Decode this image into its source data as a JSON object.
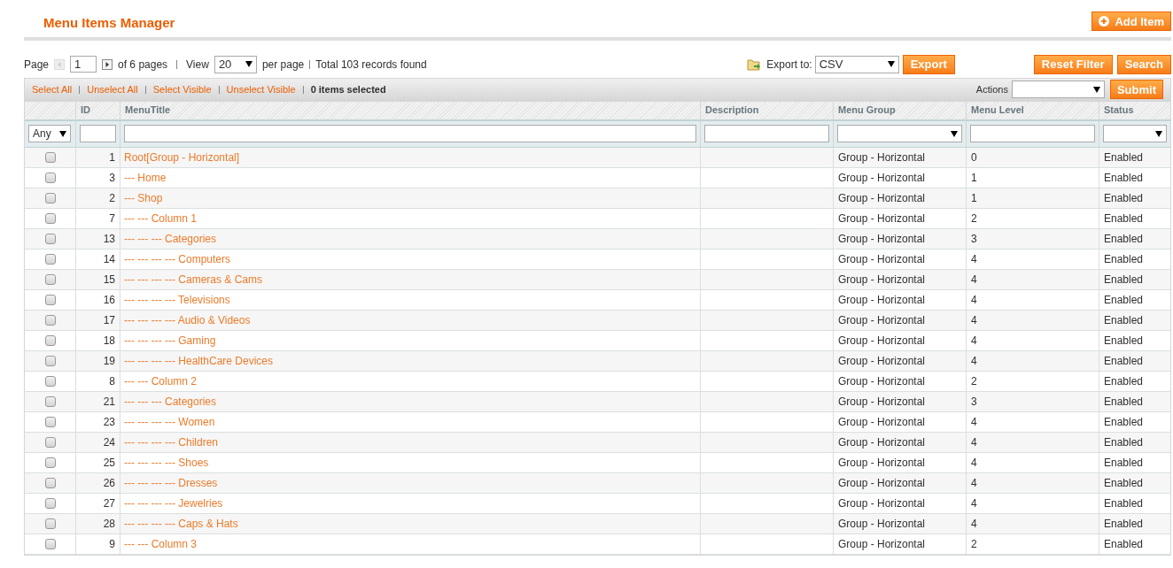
{
  "title": "Menu Items Manager",
  "add_button": "Add Item",
  "pager": {
    "page_label": "Page",
    "page": "1",
    "of_pages": "of 6 pages",
    "view_label": "View",
    "per_page": "20",
    "per_page_label": "per page",
    "total": "Total 103 records found"
  },
  "export": {
    "label": "Export to:",
    "format": "CSV",
    "button": "Export"
  },
  "filter_buttons": [
    "Reset Filter",
    "Search"
  ],
  "massaction": {
    "links": [
      "Select All",
      "Unselect All",
      "Select Visible",
      "Unselect Visible"
    ],
    "selected_count": "0 items selected",
    "actions_label": "Actions",
    "submit": "Submit"
  },
  "table": {
    "columns": [
      "ID",
      "MenuTitle",
      "Description",
      "Menu Group",
      "Menu Level",
      "Status"
    ],
    "filters": {
      "any": "Any"
    },
    "rows": [
      {
        "checked": false,
        "id": "1",
        "title": "Root[Group - Horizontal]",
        "group": "Group - Horizontal",
        "level": "0",
        "status": "Enabled"
      },
      {
        "checked": false,
        "id": "3",
        "title": "--- Home",
        "group": "Group - Horizontal",
        "level": "1",
        "status": "Enabled"
      },
      {
        "checked": false,
        "id": "2",
        "title": "--- Shop",
        "group": "Group - Horizontal",
        "level": "1",
        "status": "Enabled"
      },
      {
        "checked": false,
        "id": "7",
        "title": "--- --- Column 1",
        "group": "Group - Horizontal",
        "level": "2",
        "status": "Enabled"
      },
      {
        "checked": false,
        "id": "13",
        "title": "--- --- --- Categories",
        "group": "Group - Horizontal",
        "level": "3",
        "status": "Enabled"
      },
      {
        "checked": false,
        "id": "14",
        "title": "--- --- --- --- Computers",
        "group": "Group - Horizontal",
        "level": "4",
        "status": "Enabled"
      },
      {
        "checked": false,
        "id": "15",
        "title": "--- --- --- --- Cameras & Cams",
        "group": "Group - Horizontal",
        "level": "4",
        "status": "Enabled"
      },
      {
        "checked": false,
        "id": "16",
        "title": "--- --- --- --- Televisions",
        "group": "Group - Horizontal",
        "level": "4",
        "status": "Enabled"
      },
      {
        "checked": false,
        "id": "17",
        "title": "--- --- --- --- Audio & Videos",
        "group": "Group - Horizontal",
        "level": "4",
        "status": "Enabled"
      },
      {
        "checked": false,
        "id": "18",
        "title": "--- --- --- --- Gaming",
        "group": "Group - Horizontal",
        "level": "4",
        "status": "Enabled"
      },
      {
        "checked": false,
        "id": "19",
        "title": "--- --- --- --- HealthCare Devices",
        "group": "Group - Horizontal",
        "level": "4",
        "status": "Enabled"
      },
      {
        "checked": false,
        "id": "8",
        "title": "--- --- Column 2",
        "group": "Group - Horizontal",
        "level": "2",
        "status": "Enabled"
      },
      {
        "checked": false,
        "id": "21",
        "title": "--- --- --- Categories",
        "group": "Group - Horizontal",
        "level": "3",
        "status": "Enabled"
      },
      {
        "checked": false,
        "id": "23",
        "title": "--- --- --- --- Women",
        "group": "Group - Horizontal",
        "level": "4",
        "status": "Enabled"
      },
      {
        "checked": false,
        "id": "24",
        "title": "--- --- --- --- Children",
        "group": "Group - Horizontal",
        "level": "4",
        "status": "Enabled"
      },
      {
        "checked": false,
        "id": "25",
        "title": "--- --- --- --- Shoes",
        "group": "Group - Horizontal",
        "level": "4",
        "status": "Enabled"
      },
      {
        "checked": false,
        "id": "26",
        "title": "--- --- --- --- Dresses",
        "group": "Group - Horizontal",
        "level": "4",
        "status": "Enabled"
      },
      {
        "checked": false,
        "id": "27",
        "title": "--- --- --- --- Jewelries",
        "group": "Group - Horizontal",
        "level": "4",
        "status": "Enabled"
      },
      {
        "checked": false,
        "id": "28",
        "title": "--- --- --- --- Caps & Hats",
        "group": "Group - Horizontal",
        "level": "4",
        "status": "Enabled"
      },
      {
        "checked": false,
        "id": "9",
        "title": "--- --- Column 3",
        "group": "Group - Horizontal",
        "level": "2",
        "status": "Enabled"
      }
    ]
  }
}
